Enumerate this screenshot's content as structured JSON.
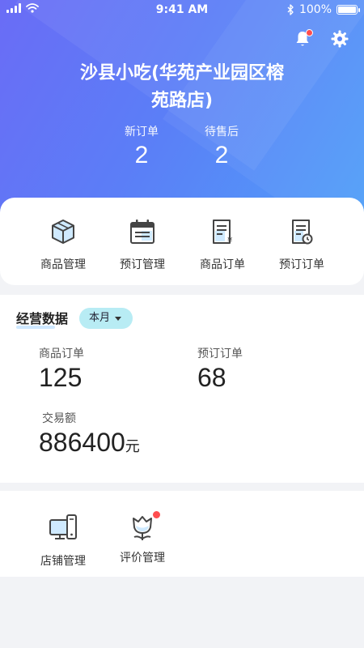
{
  "status_bar": {
    "time": "9:41 AM",
    "battery": "100%"
  },
  "header": {
    "store_name": "沙县小吃(华苑产业园区榕苑路店)",
    "counters": [
      {
        "label": "新订单",
        "value": "2"
      },
      {
        "label": "待售后",
        "value": "2"
      }
    ]
  },
  "quick_menu": [
    {
      "label": "商品管理",
      "icon": "cube-icon"
    },
    {
      "label": "预订管理",
      "icon": "calendar-icon"
    },
    {
      "label": "商品订单",
      "icon": "yen-receipt-icon"
    },
    {
      "label": "预订订单",
      "icon": "clock-receipt-icon"
    }
  ],
  "stats": {
    "title": "经营数据",
    "period": "本月",
    "metrics": [
      {
        "label": "商品订单",
        "value": "125"
      },
      {
        "label": "预订订单",
        "value": "68"
      },
      {
        "label": "交易额",
        "value": "886400",
        "unit": "元"
      }
    ]
  },
  "tools": [
    {
      "label": "店铺管理",
      "icon": "devices-icon"
    },
    {
      "label": "评价管理",
      "icon": "flower-icon",
      "has_badge": true
    }
  ],
  "colors": {
    "primary_start": "#6a6cf6",
    "primary_end": "#4fa0f8",
    "accent": "#1f9de6",
    "badge": "#ff4d4f"
  }
}
